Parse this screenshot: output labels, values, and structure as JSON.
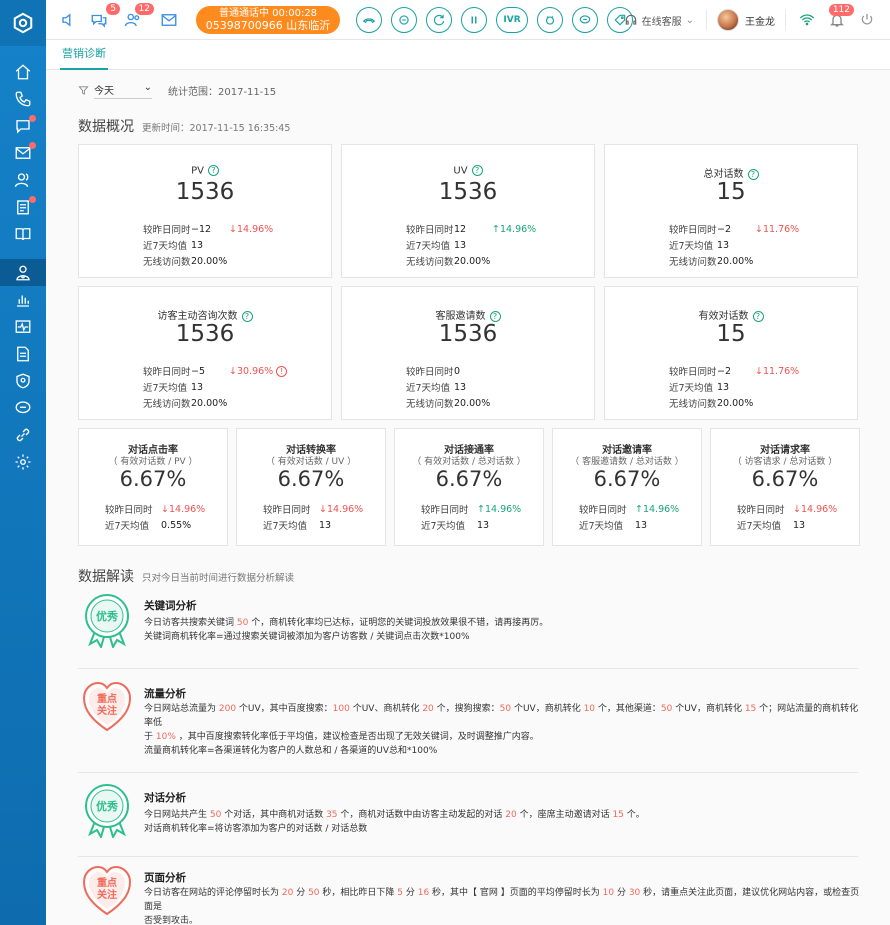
{
  "topbar": {
    "badges": {
      "chat": "5",
      "visitors": "12",
      "notify": "112"
    },
    "call_status": "普通通话中  00:00:28",
    "call_number": "05398700966 山东临沂",
    "controls": [
      "hangup",
      "transfer",
      "refresh",
      "pause",
      "IVR",
      "consult",
      "sms",
      "tag"
    ],
    "ivr_label": "IVR",
    "service_status": "在线客服",
    "user_name": "王金龙"
  },
  "tabs": {
    "active": "营销诊断"
  },
  "filter": {
    "selected": "今天",
    "range_label": "统计范围：2017-11-15"
  },
  "overview": {
    "title": "数据概况",
    "updated": "更新时间：2017-11-15  16:35:45",
    "row_labels": {
      "yesterday": "较昨日同时",
      "avg7": "近7天均值",
      "wireless": "无线访问数"
    },
    "cards": [
      {
        "title": "PV",
        "value": "1536",
        "yday": "−12",
        "change": "↓14.96%",
        "dir": "down",
        "avg7": "13",
        "wireless": "20.00%"
      },
      {
        "title": "UV",
        "value": "1536",
        "yday": "12",
        "change": "↑14.96%",
        "dir": "up",
        "avg7": "13",
        "wireless": "20.00%"
      },
      {
        "title": "总对话数",
        "value": "15",
        "yday": "−2",
        "change": "↓11.76%",
        "dir": "down",
        "avg7": "13",
        "wireless": "20.00%"
      },
      {
        "title": "访客主动咨询次数",
        "value": "1536",
        "yday": "−5",
        "change": "↓30.96%",
        "dir": "down",
        "avg7": "13",
        "wireless": "20.00%"
      },
      {
        "title": "客服邀请数",
        "value": "1536",
        "yday": "0",
        "change": "",
        "dir": "",
        "avg7": "13",
        "wireless": "20.00%"
      },
      {
        "title": "有效对话数",
        "value": "15",
        "yday": "−2",
        "change": "↓11.76%",
        "dir": "down",
        "avg7": "13",
        "wireless": "20.00%"
      }
    ],
    "rates": [
      {
        "title": "对话点击率",
        "formula": "（ 有效对话数 / PV ）",
        "value": "6.67%",
        "change": "↓14.96%",
        "dir": "down",
        "avg7": "0.55%"
      },
      {
        "title": "对话转换率",
        "formula": "（ 有效对话数 / UV ）",
        "value": "6.67%",
        "change": "↓14.96%",
        "dir": "down",
        "avg7": "13"
      },
      {
        "title": "对话接通率",
        "formula": "（ 有效对话数 / 总对话数 ）",
        "value": "6.67%",
        "change": "↑14.96%",
        "dir": "up",
        "avg7": "13"
      },
      {
        "title": "对话邀请率",
        "formula": "（ 客服邀请数 / 总对话数 ）",
        "value": "6.67%",
        "change": "↑14.96%",
        "dir": "up",
        "avg7": "13"
      },
      {
        "title": "对话请求率",
        "formula": "（ 访客请求 / 总对话数 ）",
        "value": "6.67%",
        "change": "↓14.96%",
        "dir": "down",
        "avg7": "13"
      }
    ]
  },
  "analysis": {
    "title": "数据解读",
    "subtitle": "只对今日当前时间进行数据分析解读",
    "badge_good": "优秀",
    "badge_focus_1": "重点",
    "badge_focus_2": "关注",
    "items": [
      {
        "title": "关键词分析",
        "badge": "good"
      },
      {
        "title": "流量分析",
        "badge": "focus"
      },
      {
        "title": "对话分析",
        "badge": "good"
      },
      {
        "title": "页面分析",
        "badge": "focus"
      }
    ],
    "kw": {
      "a": "今日访客共搜索关键词 ",
      "n1": "50",
      "b": " 个，商机转化率均已达标，证明您的关键词投放效果很不错，请再接再厉。",
      "formula": "关键词商机转化率=通过搜索关键词被添加为客户访客数 / 关键词点击次数*100%"
    },
    "flow": {
      "t1": "今日网站总流量为 ",
      "n1": "200",
      "t2": " 个UV，其中百度搜索：",
      "n2": "100",
      "t3": " 个UV、商机转化 ",
      "n3": "20",
      "t4": " 个，搜狗搜索：",
      "n4": "50",
      "t5": " 个UV，商机转化 ",
      "n5": "10",
      "t6": " 个，其他渠道：",
      "n6": "50",
      "t7": " 个UV，商机转化 ",
      "n7": "15",
      "t8": " 个；网站流量的商机转化率低",
      "t9": "于 ",
      "n8": "10%",
      "t10": " ，其中百度搜索转化率低于平均值，建议检查是否出现了无效关键词，及时调整推广内容。",
      "formula": "流量商机转化率=各渠道转化为客户的人数总和 / 各渠道的UV总和*100%"
    },
    "dialog": {
      "t1": "今日网站共产生 ",
      "n1": "50",
      "t2": " 个对话，其中商机对话数 ",
      "n2": "35",
      "t3": " 个，商机对话数中由访客主动发起的对话 ",
      "n3": "20",
      "t4": " 个，座席主动邀请对话 ",
      "n4": "15",
      "t5": " 个。",
      "formula": "对话商机转化率=将访客添加为客户的对话数 / 对话总数"
    },
    "page": {
      "t1": "今日访客在网站的评论停留时长为 ",
      "n1": "20",
      "t2": " 分 ",
      "n2": "50",
      "t3": " 秒，相比昨日下降 ",
      "n3": "5",
      "t4": " 分 ",
      "n4": "16",
      "t5": " 秒，其中【 官网 】页面的平均停留时长为 ",
      "n5": "10",
      "t6": " 分 ",
      "n6": "30",
      "t7": " 秒，请重点关注此页面，建议优化网站内容，或检查页面是",
      "t8": "否受到攻击。"
    }
  },
  "colors": {
    "sidebar": "#1582c9",
    "accent": "#19a3a3",
    "orange": "#ff8a1e",
    "down": "#ef5350",
    "up": "#1aa37a"
  }
}
